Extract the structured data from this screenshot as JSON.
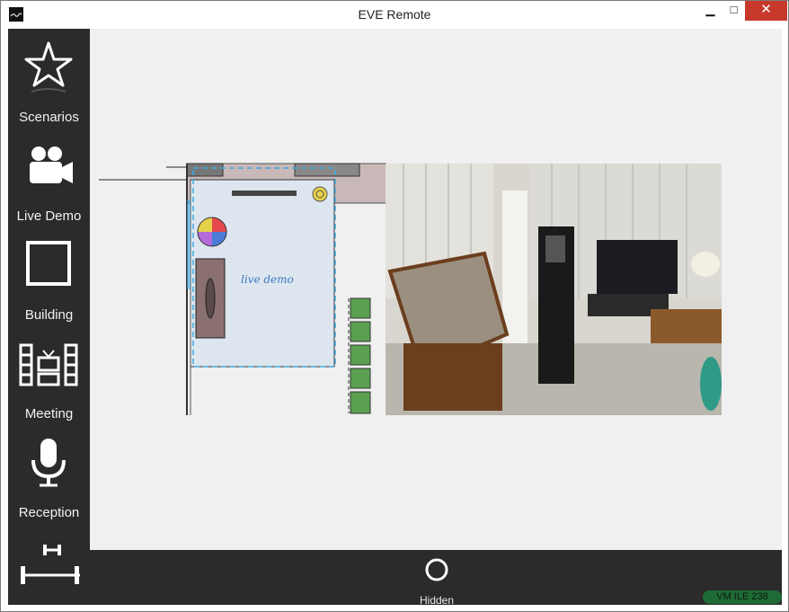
{
  "window": {
    "title": "EVE Remote",
    "controls": {
      "minimize": "▁",
      "maximize": "□",
      "close": "✕"
    }
  },
  "sidebar": {
    "items": [
      {
        "label": "Scenarios",
        "icon": "star-icon"
      },
      {
        "label": "Live Demo",
        "icon": "video-camera-icon"
      },
      {
        "label": "Building",
        "icon": "square-icon"
      },
      {
        "label": "Meeting",
        "icon": "meeting-room-icon"
      },
      {
        "label": "Reception",
        "icon": "microphone-icon"
      },
      {
        "label": "",
        "icon": "dumbbell-icon"
      }
    ]
  },
  "floorplan": {
    "room_label": "live demo"
  },
  "bottombar": {
    "hidden_label": "Hidden",
    "status": "VM ILE 238"
  },
  "colors": {
    "sidebar_bg": "#2b2b2b",
    "canvas_bg": "#f0f0f0",
    "close_button": "#c7392b",
    "status_badge": "#1e6b35",
    "room_highlight": "#3fa9e0"
  }
}
